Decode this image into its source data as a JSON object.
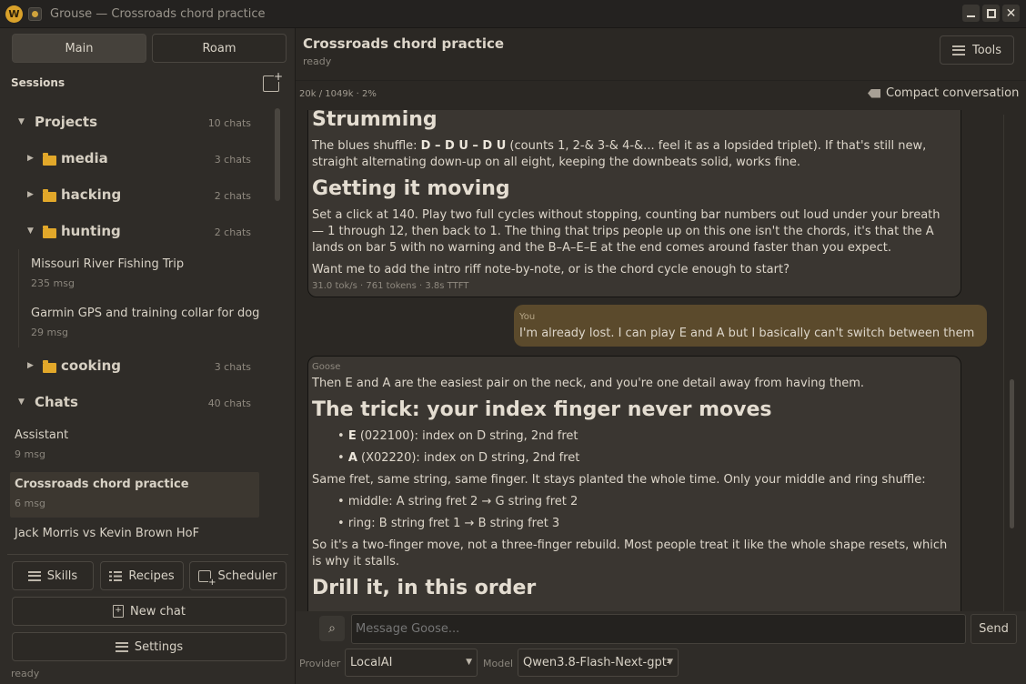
{
  "window": {
    "title": "Grouse — Crossroads chord practice",
    "logo_letter": "W"
  },
  "sidebar": {
    "modes": [
      "Main",
      "Roam"
    ],
    "sessions_label": "Sessions",
    "tree": {
      "projects": {
        "label": "Projects",
        "count": "10 chats"
      },
      "folders": [
        {
          "label": "media",
          "count": "3 chats"
        },
        {
          "label": "hacking",
          "count": "2 chats"
        },
        {
          "label": "hunting",
          "count": "2 chats"
        },
        {
          "label": "cooking",
          "count": "3 chats"
        }
      ],
      "hunting_chats": [
        {
          "title": "Missouri River Fishing Trip",
          "msgs": "235 msg"
        },
        {
          "title": "Garmin GPS and training collar for dog",
          "msgs": "29 msg"
        }
      ],
      "chats": {
        "label": "Chats",
        "count": "40 chats"
      },
      "chat_list": [
        {
          "title": "Assistant",
          "msgs": "9 msg"
        },
        {
          "title": "Crossroads chord practice",
          "msgs": "6 msg"
        },
        {
          "title": "Jack Morris vs Kevin Brown HoF",
          "msgs": ""
        }
      ]
    },
    "buttons": {
      "skills": "Skills",
      "recipes": "Recipes",
      "scheduler": "Scheduler",
      "new_chat": "New chat",
      "settings": "Settings"
    },
    "status": "ready"
  },
  "main": {
    "title": "Crossroads chord practice",
    "status": "ready",
    "tools_label": "Tools",
    "token_info": "20k / 1049k · 2%",
    "compact_label": "Compact conversation",
    "messages": {
      "m1": {
        "h_strumming": "Strumming",
        "p_strumming_pre": "The blues shuffle: ",
        "p_strumming_bold": "D – D U – D U",
        "p_strumming_post": " (counts 1, 2-& 3-& 4-&... feel it as a lopsided triplet). If that's still new, straight alternating down-up on all eight, keeping the downbeats solid, works fine.",
        "h_moving": "Getting it moving",
        "p_moving": "Set a click at 140. Play two full cycles without stopping, counting bar numbers out loud under your breath — 1 through 12, then back to 1. The thing that trips people up on this one isn't the chords, it's that the A lands on bar 5 with no warning and the B–A–E–E at the end comes around faster than you expect.",
        "p_question": "Want me to add the intro riff note-by-note, or is the chord cycle enough to start?",
        "stats": "31.0 tok/s · 761 tokens · 3.8s TTFT"
      },
      "user": {
        "sender": "You",
        "text": "I'm already lost. I can play E and A but I basically can't switch between them"
      },
      "m2": {
        "sender": "Goose",
        "intro": "Then E and A are the easiest pair on the neck, and you're one detail away from having them.",
        "h_trick": "The trick: your index finger never moves",
        "li_e_bold": "E",
        "li_e_rest": " (022100): index on D string, 2nd fret",
        "li_a_bold": "A",
        "li_a_rest": " (X02220): index on D string, 2nd fret",
        "p_same": "Same fret, same string, same finger. It stays planted the whole time. Only your middle and ring shuffle:",
        "li_middle": "middle: A string fret 2 → G string fret 2",
        "li_ring": "ring: B string fret 1 → B string fret 3",
        "p_two": "So it's a two-finger move, not a three-finger rebuild. Most people treat it like the whole shape resets, which is why it stalls.",
        "h_drill": "Drill it, in this order"
      }
    },
    "composer": {
      "placeholder": "Message Goose...",
      "send_label": "Send",
      "provider_label": "Provider",
      "provider_value": "LocalAI",
      "model_label": "Model",
      "model_value": "Qwen3.8-Flash-Next-gpt-"
    }
  },
  "colors": {
    "accent": "#e2a82a",
    "user_bubble": "#5b4a2c",
    "assistant_bubble": "#3a3631",
    "background": "#2b2824"
  }
}
